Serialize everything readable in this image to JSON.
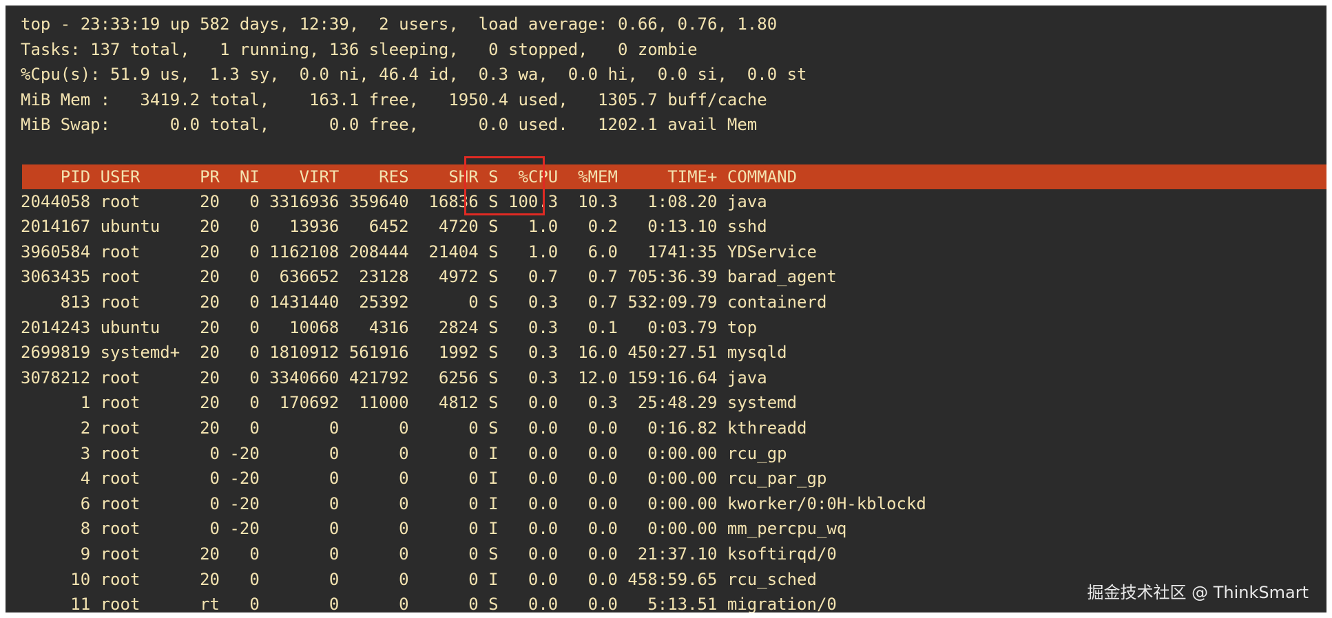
{
  "summary": [
    "top - 23:33:19 up 582 days, 12:39,  2 users,  load average: 0.66, 0.76, 1.80",
    "Tasks: 137 total,   1 running, 136 sleeping,   0 stopped,   0 zombie",
    "%Cpu(s): 51.9 us,  1.3 sy,  0.0 ni, 46.4 id,  0.3 wa,  0.0 hi,  0.0 si,  0.0 st",
    "MiB Mem :   3419.2 total,    163.1 free,   1950.4 used,   1305.7 buff/cache",
    "MiB Swap:      0.0 total,      0.0 free,      0.0 used.   1202.1 avail Mem"
  ],
  "header": "    PID USER      PR  NI    VIRT    RES    SHR S  %CPU  %MEM     TIME+ COMMAND",
  "rows": [
    "2044058 root      20   0 3316936 359640  16836 S 100.3  10.3   1:08.20 java",
    "2014167 ubuntu    20   0   13936   6452   4720 S   1.0   0.2   0:13.10 sshd",
    "3960584 root      20   0 1162108 208444  21404 S   1.0   6.0   1741:35 YDService",
    "3063435 root      20   0  636652  23128   4972 S   0.7   0.7 705:36.39 barad_agent",
    "    813 root      20   0 1431440  25392      0 S   0.3   0.7 532:09.79 containerd",
    "2014243 ubuntu    20   0   10068   4316   2824 S   0.3   0.1   0:03.79 top",
    "2699819 systemd+  20   0 1810912 561916   1992 S   0.3  16.0 450:27.51 mysqld",
    "3078212 root      20   0 3340660 421792   6256 S   0.3  12.0 159:16.64 java",
    "      1 root      20   0  170692  11000   4812 S   0.0   0.3  25:48.29 systemd",
    "      2 root      20   0       0      0      0 S   0.0   0.0   0:16.82 kthreadd",
    "      3 root       0 -20       0      0      0 I   0.0   0.0   0:00.00 rcu_gp",
    "      4 root       0 -20       0      0      0 I   0.0   0.0   0:00.00 rcu_par_gp",
    "      6 root       0 -20       0      0      0 I   0.0   0.0   0:00.00 kworker/0:0H-kblockd",
    "      8 root       0 -20       0      0      0 I   0.0   0.0   0:00.00 mm_percpu_wq",
    "      9 root      20   0       0      0      0 S   0.0   0.0  21:37.10 ksoftirqd/0",
    "     10 root      20   0       0      0      0 I   0.0   0.0 458:59.65 rcu_sched",
    "     11 root      rt   0       0      0      0 S   0.0   0.0   5:13.51 migration/0"
  ],
  "watermark": "掘金技术社区 @ ThinkSmart",
  "colors": {
    "background": "#2b2b2b",
    "text": "#f3e3b0",
    "header_bar": "#c4421e",
    "highlight_box": "#e02a23"
  }
}
